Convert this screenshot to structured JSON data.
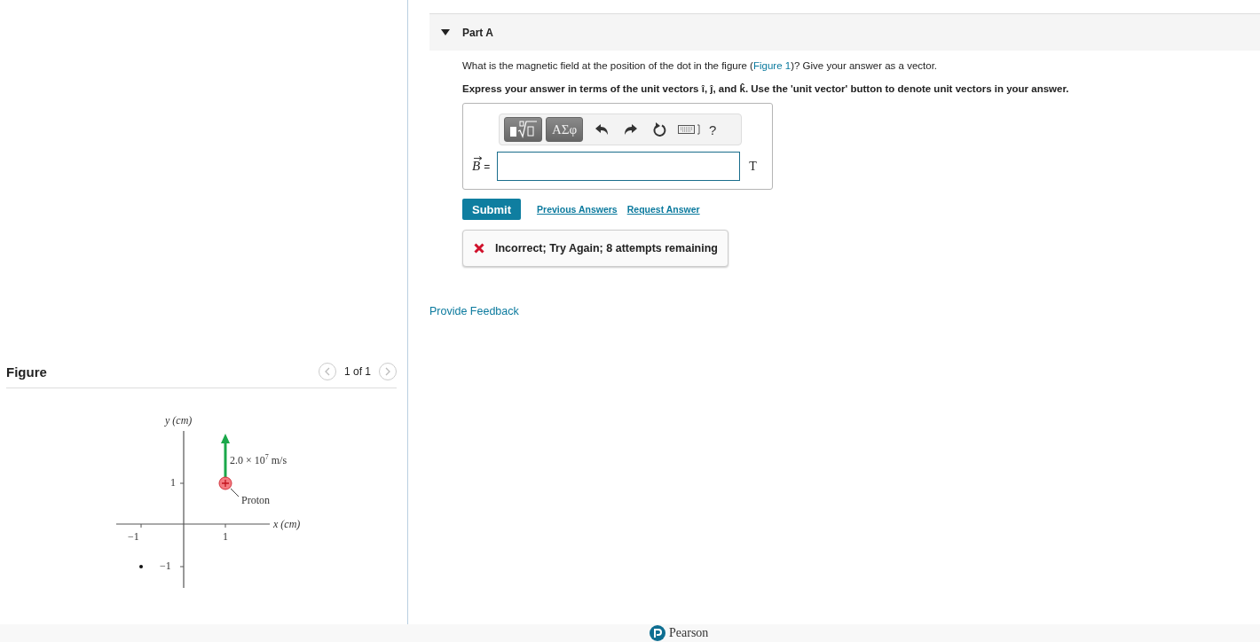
{
  "figure_panel": {
    "title": "Figure",
    "pager": "1 of 1",
    "diagram": {
      "y_axis_label": "y (cm)",
      "x_axis_label": "x (cm)",
      "x_ticks": [
        "−1",
        "1"
      ],
      "y_ticks": [
        "1",
        "−1"
      ],
      "velocity_label": "2.0 × 10$^{7}$ m/s",
      "particle_label": "Proton"
    }
  },
  "part": {
    "title": "Part A",
    "expanded": true,
    "question": {
      "before": "What is the magnetic field at the position of the dot in the figure (",
      "link": "Figure 1",
      "after": ")? Give your answer as a vector."
    },
    "instruction": "Express your answer in terms of the unit vectors î, ĵ, and k̂. Use the 'unit vector' button to denote unit vectors in your answer.",
    "toolbar": {
      "greek_button": "ΑΣφ",
      "help_button": "?"
    },
    "answer": {
      "symbol": "B",
      "equals": "=",
      "unit": "T"
    },
    "actions": {
      "submit": "Submit",
      "links": [
        "Previous Answers",
        "Request Answer"
      ]
    },
    "feedback": {
      "kind": "incorrect",
      "message": "Incorrect; Try Again; 8 attempts remaining"
    }
  },
  "provide_feedback": "Provide Feedback",
  "footer": {
    "brand": "Pearson"
  }
}
